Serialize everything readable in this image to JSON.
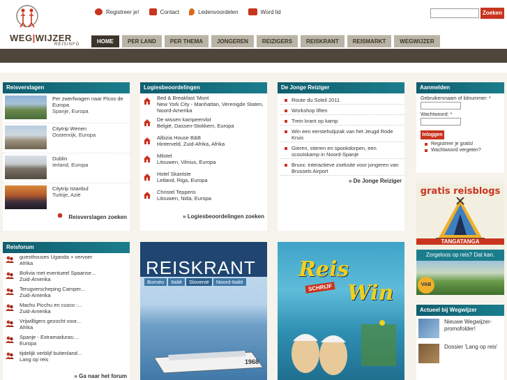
{
  "header": {
    "logo_main_1": "WEG",
    "logo_main_2": "WIJZER",
    "logo_sub": "REISINFO",
    "toplinks": [
      {
        "label": "Registreer je!",
        "icon": "user-icon",
        "color": "#c8341e"
      },
      {
        "label": "Contact",
        "icon": "mail-icon",
        "color": "#c8341e"
      },
      {
        "label": "Ledenvoordelen",
        "icon": "tag-icon",
        "color": "#d9691f"
      },
      {
        "label": "Word lid",
        "icon": "card-icon",
        "color": "#c8341e"
      }
    ],
    "search_button": "Zoeken"
  },
  "nav": [
    "HOME",
    "PER LAND",
    "PER THEMA",
    "JONGEREN",
    "REIZIGERS",
    "REISKRANT",
    "REISMARKT",
    "WEGWIJZER"
  ],
  "reisverslagen": {
    "title": "Reisverslagen",
    "items": [
      {
        "title": "Per zwerfwagen naar Picos de Europa",
        "sub": "Spanje, Europa"
      },
      {
        "title": "Citytrip Wenen",
        "sub": "Oostenrijk, Europa"
      },
      {
        "title": "Dublin",
        "sub": "Ierland, Europa"
      },
      {
        "title": "Citytrip Istanbul",
        "sub": "Turkije, Azië"
      }
    ],
    "more": "Reisverslagen zoeken"
  },
  "logies": {
    "title": "Logiesbeoordelingen",
    "items": [
      {
        "title": "Bed & Breakfast 'Mont",
        "sub": "New York City - Manhattan, Verenigde Staten, Noord-Amerika"
      },
      {
        "title": "De wissen kampeervlot",
        "sub": "België, Dassen-Stokkem, Europa"
      },
      {
        "title": "Albizia House B&B",
        "sub": "Hinterveld, Zuid-Afrika, Afrika"
      },
      {
        "title": "Milotel",
        "sub": "Litouwen, Vilnius, Europa"
      },
      {
        "title": "Hotel Skantste",
        "sub": "Letland, Riga, Europa"
      },
      {
        "title": "Christel Tepperis",
        "sub": "Litouwen, Nida, Europa"
      }
    ],
    "more": "» Logiesbeoordelingen zoeken"
  },
  "jonge": {
    "title": "De Jonge Reiziger",
    "items": [
      "Route du Soleil 2011",
      "Workshop liften",
      "Trein krant op kamp",
      "Win een eerstehulpzak van het Jeugd Rode Kruis",
      "Gieren, stieren en spookdorpen, een scoutskamp in Noord-Spanje",
      "Bruxx: interactieve zoeksite voor jongeren van Brussels Airport"
    ],
    "more": "» De Jonge Reiziger"
  },
  "forum": {
    "title": "Reisforum",
    "items": [
      {
        "title": "guesthouses Uganda + vervoer",
        "sub": "Afrika"
      },
      {
        "title": "Bolivia met eventueel Spaanse...",
        "sub": "Zuid-Amerika"
      },
      {
        "title": "Terugverscheping Camper...",
        "sub": "Zuid-Amerika"
      },
      {
        "title": "Machu Picchu en cusco :...",
        "sub": "Zuid-Amerika"
      },
      {
        "title": "Vrijwilligers gezocht voor...",
        "sub": "Afrika"
      },
      {
        "title": "Spanje - Extramaduras:...",
        "sub": "Europa"
      },
      {
        "title": "tijdelijk verblijf buitenland...",
        "sub": "Lang op reis"
      }
    ],
    "more": "» Ga naar het forum"
  },
  "reiskrant": {
    "masthead": "REISKRANT",
    "tags": [
      "Bornéo",
      "Italië",
      "Slovenië",
      "Noord-Italië"
    ],
    "boat_number": "1968"
  },
  "reiswin": {
    "line1": "Reis",
    "line2": "Win",
    "tag": "SCHRIJF"
  },
  "login": {
    "title": "Aanmelden",
    "user_label": "Gebruikersnaam of lidnummer: *",
    "pass_label": "Wachtwoord: *",
    "button": "Inloggen",
    "links": [
      "Registreer je gratis!",
      "Wachtwoord vergeten?"
    ]
  },
  "ad_tanga": {
    "title": "gratis reisblogs",
    "brand": "TANGATANGA",
    "tagline": "Zorgeloos op reis? Dat kan.",
    "badge": "VAB"
  },
  "actueel": {
    "title": "Actueel bij Wegwijzer",
    "items": [
      "Nieuwe Wegwijzer-promofolder!",
      "Dossier 'Lang op reis'"
    ]
  }
}
